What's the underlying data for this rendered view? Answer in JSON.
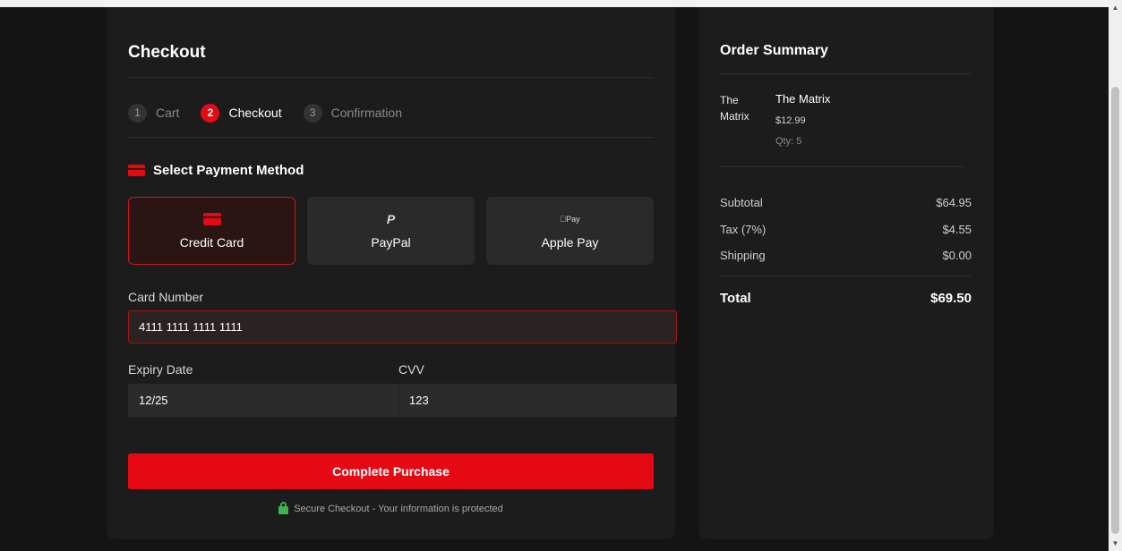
{
  "checkout": {
    "title": "Checkout",
    "steps": [
      {
        "num": "1",
        "label": "Cart"
      },
      {
        "num": "2",
        "label": "Checkout"
      },
      {
        "num": "3",
        "label": "Confirmation"
      }
    ],
    "payment_section_title": "Select Payment Method",
    "methods": [
      {
        "label": "Credit Card",
        "icon": "credit-card-icon"
      },
      {
        "label": "PayPal",
        "icon": "paypal-icon",
        "icon_text": "P"
      },
      {
        "label": "Apple Pay",
        "icon": "apple-pay-icon",
        "icon_text": "Pay"
      }
    ],
    "card_number_label": "Card Number",
    "card_number_value": "4111 1111 1111 1111",
    "expiry_label": "Expiry Date",
    "expiry_value": "12/25",
    "cvv_label": "CVV",
    "cvv_value": "123",
    "purchase_button": "Complete Purchase",
    "secure_note": "Secure Checkout - Your information is protected"
  },
  "summary": {
    "title": "Order Summary",
    "item": {
      "image_alt": "The Matrix",
      "name": "The Matrix",
      "price": "$12.99",
      "qty": "Qty: 5"
    },
    "subtotal_label": "Subtotal",
    "subtotal_value": "$64.95",
    "tax_label": "Tax (7%)",
    "tax_value": "$4.55",
    "shipping_label": "Shipping",
    "shipping_value": "$0.00",
    "total_label": "Total",
    "total_value": "$69.50"
  },
  "colors": {
    "accent": "#e50914",
    "background": "#141414",
    "panel": "#1c1c1c",
    "secure": "#3cb54a"
  }
}
